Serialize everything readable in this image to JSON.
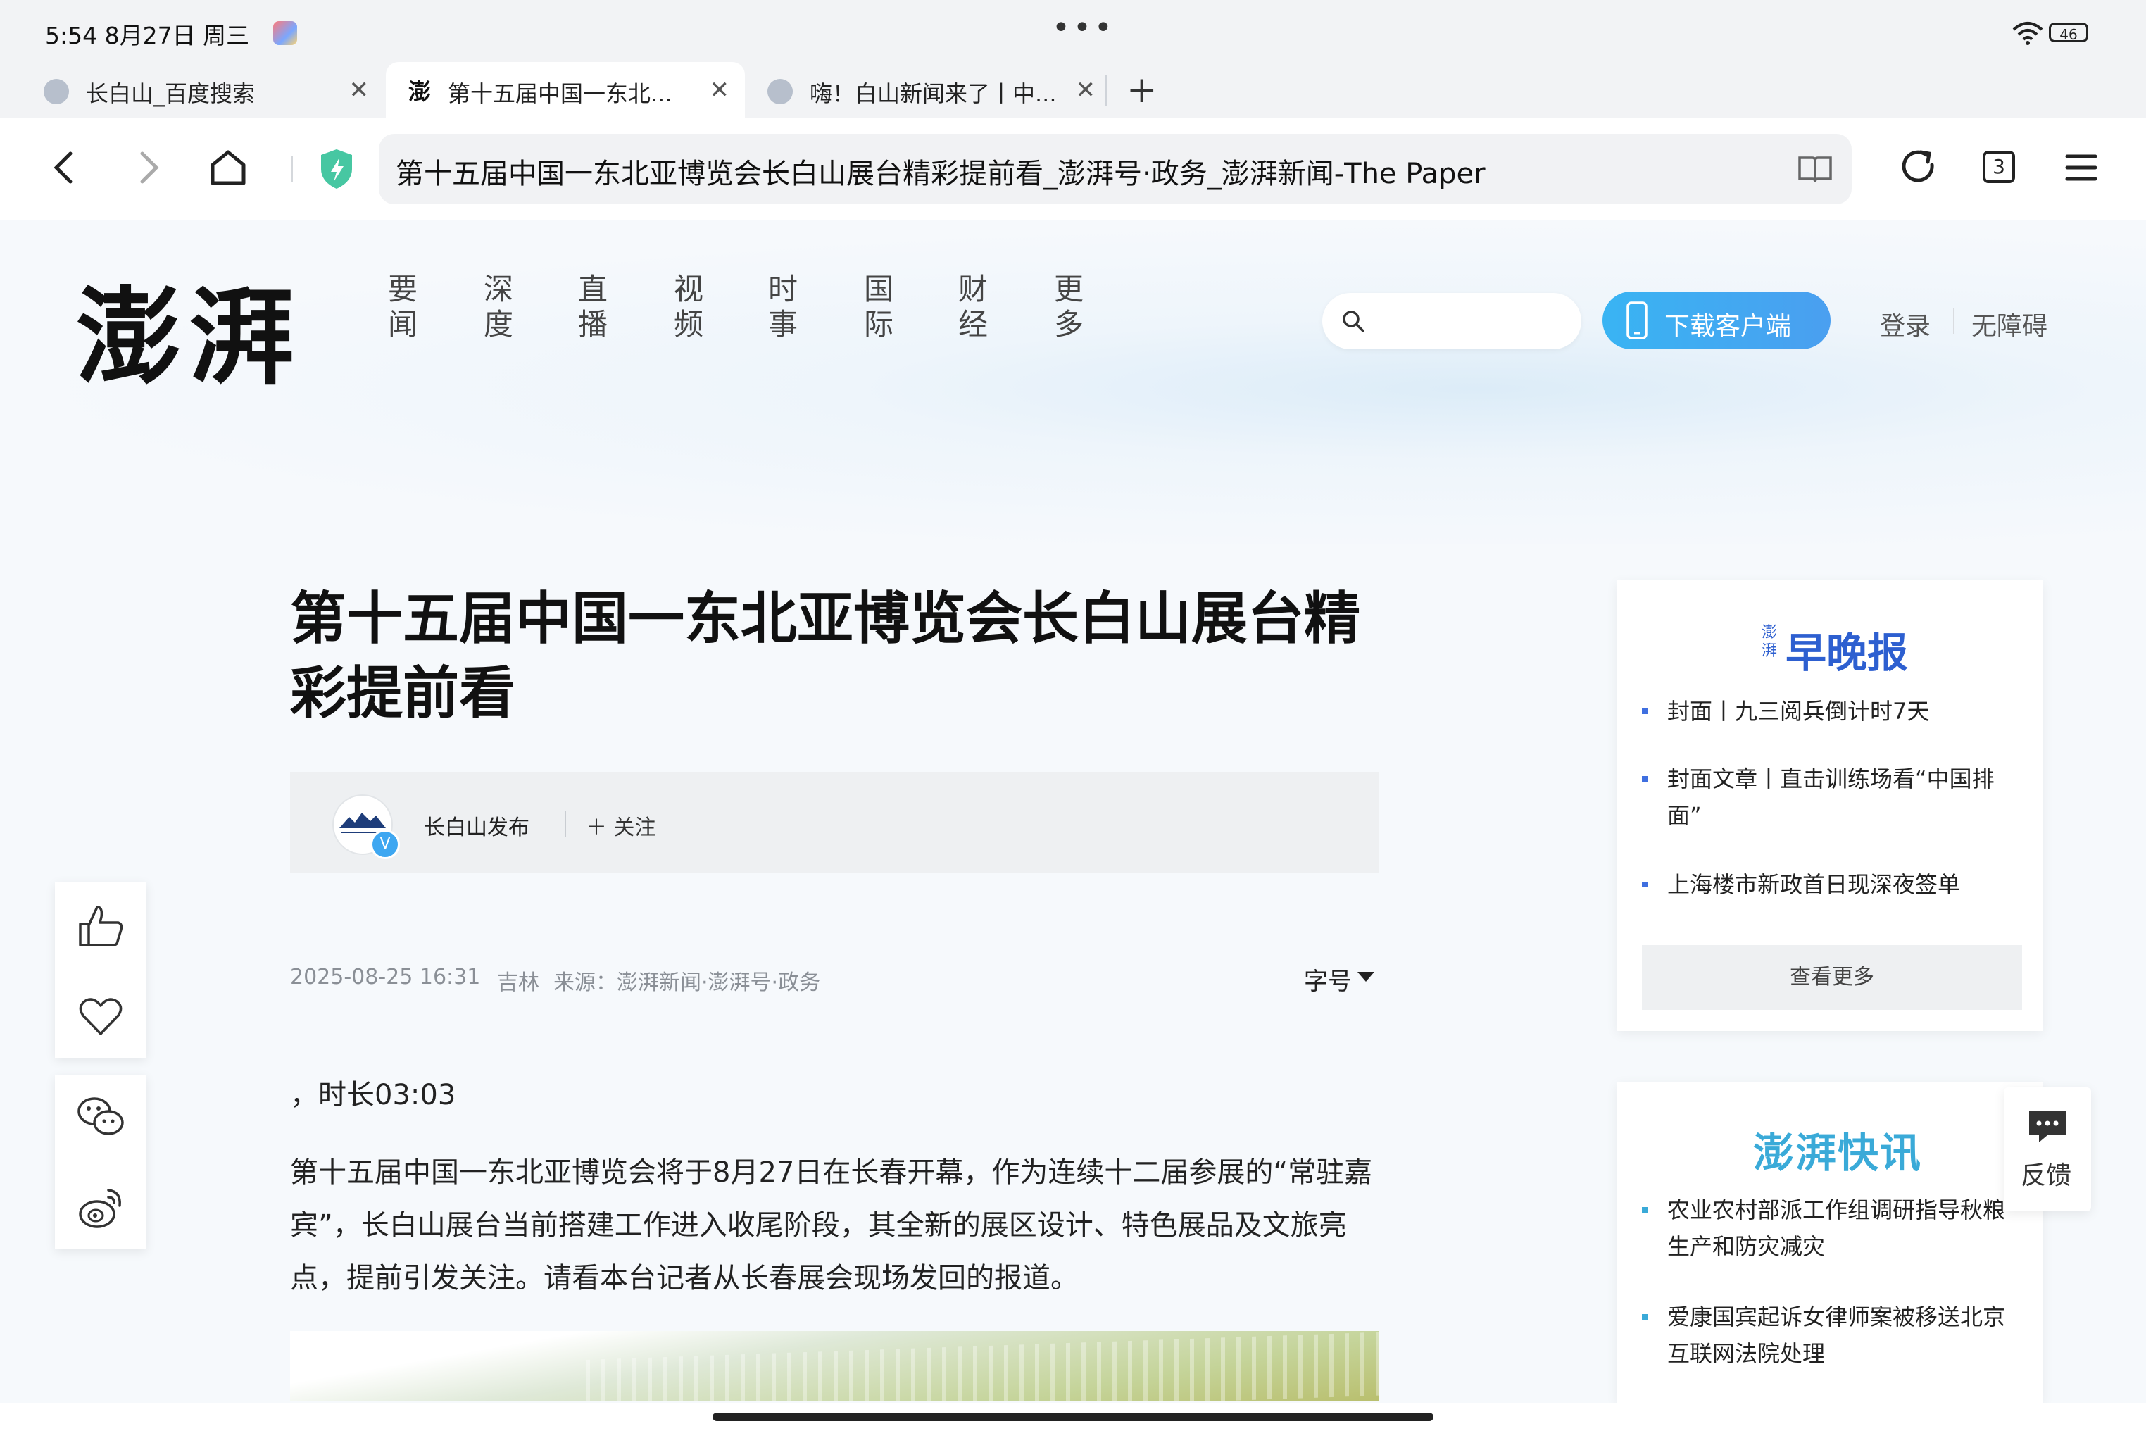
{
  "status_bar": {
    "time": "5:54  8月27日 周三",
    "dots": "•••",
    "battery": "46"
  },
  "tabs": [
    {
      "title": "长白山_百度搜索",
      "close": "✕"
    },
    {
      "title": "第十五届中国一东北...",
      "close": "✕"
    },
    {
      "title": "嗨！白山新闻来了丨中...",
      "close": "✕"
    }
  ],
  "tab_add": "+",
  "toolbar": {
    "url": "第十五届中国一东北亚博览会长白山展台精彩提前看_澎湃号·政务_澎湃新闻-The Paper",
    "tab_count": "3"
  },
  "header": {
    "logo": "澎湃",
    "nav": [
      {
        "label": "要闻"
      },
      {
        "label": "深度"
      },
      {
        "label": "直播"
      },
      {
        "label": "视频"
      },
      {
        "label": "时事"
      },
      {
        "label": "国际"
      },
      {
        "label": "财经"
      },
      {
        "label": "更多"
      }
    ],
    "download": "下载客户端",
    "login": "登录",
    "accessibility": "无障碍"
  },
  "article": {
    "title": "第十五届中国一东北亚博览会长白山展台精彩提前看",
    "author": "长白山发布",
    "verified": "V",
    "follow": "＋ 关注",
    "date": "2025-08-25 16:31",
    "location": "吉林",
    "source": "来源：澎湃新闻·澎湃号·政务",
    "font_size": "字号",
    "duration": "，时长03:03",
    "body": "第十五届中国一东北亚博览会将于8月27日在长春开幕，作为连续十二届参展的“常驻嘉宾”，长白山展台当前搭建工作进入收尾阶段，其全新的展区设计、特色展品及文旅亮点，提前引发关注。请看本台记者从长春展会现场发回的报道。"
  },
  "sidebar": {
    "card1": {
      "logo_small": "澎湃",
      "logo": "早晚报",
      "items": [
        {
          "text": "封面丨九三阅兵倒计时7天"
        },
        {
          "text": "封面文章丨直击训练场看“中国排面”"
        },
        {
          "text": "上海楼市新政首日现深夜签单"
        }
      ],
      "more": "查看更多"
    },
    "card2": {
      "logo": "澎湃快讯",
      "items": [
        {
          "text": "农业农村部派工作组调研指导秋粮生产和防灾减灾"
        },
        {
          "text": "爱康国宾起诉女律师案被移送北京互联网法院处理"
        }
      ]
    }
  },
  "feedback": "反馈",
  "colors": {
    "accent": "#39b4f3",
    "sidebar_bullet": "#3f6fe0",
    "card1_logo": "#2d5fd0",
    "card2_logo": "#3aaad8"
  }
}
